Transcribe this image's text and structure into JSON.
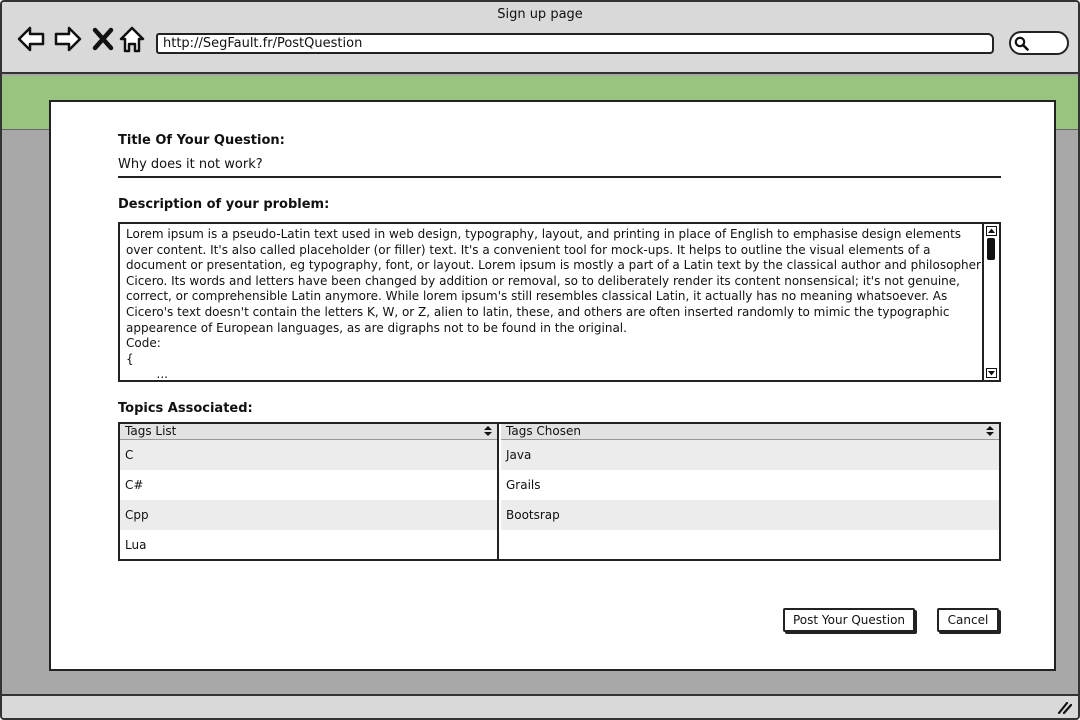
{
  "browser": {
    "window_title": "Sign up page",
    "url": "http://SegFault.fr/PostQuestion",
    "nav_icons": [
      "back-arrow-icon",
      "forward-arrow-icon",
      "close-x-icon",
      "home-icon"
    ],
    "search_icon": "magnifier-icon"
  },
  "colors": {
    "header_band": "#98c47f",
    "background": "#a8a8a8",
    "row_alt": "#ececec"
  },
  "form": {
    "title_label": "Title Of Your Question:",
    "title_value": "Why does it not work?",
    "description_label": "Description of your problem:",
    "description_text": "Lorem ipsum is a pseudo-Latin text used in web design, typography, layout, and printing in place of English to emphasise design elements over content. It's also called placeholder (or filler) text. It's a convenient tool for mock-ups. It helps to outline the visual elements of a document or presentation, eg typography, font, or layout. Lorem ipsum is mostly a part of a Latin text by the classical author and philosopher Cicero. Its words and letters have been changed by addition or removal, so to deliberately render its content nonsensical; it's not genuine, correct, or comprehensible Latin anymore. While lorem ipsum's still resembles classical Latin, it actually has no meaning whatsoever. As Cicero's text doesn't contain the letters K, W, or Z, alien to latin, these, and others are often inserted randomly to mimic the typographic appearence of European languages, as are digraphs not to be found in the original.\nCode:\n{\n        ...",
    "topics_label": "Topics Associated:",
    "tags_list": {
      "header": "Tags List",
      "items": [
        "C",
        "C#",
        "Cpp",
        "Lua"
      ]
    },
    "tags_chosen": {
      "header": "Tags Chosen",
      "items": [
        "Java",
        "Grails",
        "Bootsrap"
      ]
    },
    "post_button": "Post Your Question",
    "cancel_button": "Cancel"
  }
}
